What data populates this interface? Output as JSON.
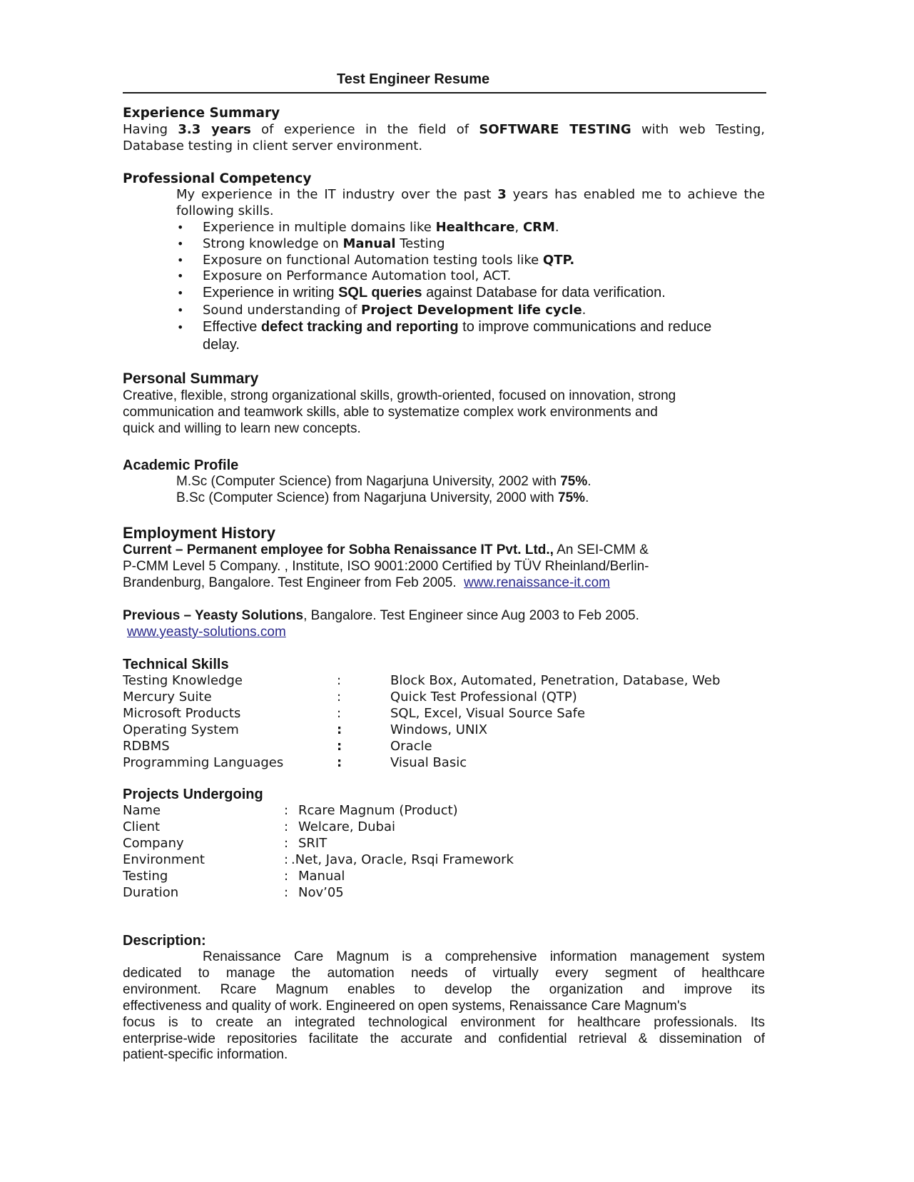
{
  "title": "Test Engineer  Resume",
  "experience_summary": {
    "heading": "Experience Summary",
    "line1_pre": "Having ",
    "line1_b1": "3.3 years",
    "line1_mid": " of experience in the field of ",
    "line1_b2": "SOFTWARE TESTING",
    "line1_post": " with web Testing,",
    "line2": "Database testing in client server environment."
  },
  "professional_competency": {
    "heading": "Professional Competency",
    "intro_pre": "My experience in the IT industry over the past ",
    "intro_b": "3",
    "intro_post": " years has enabled me to achieve the",
    "intro_line2": "following skills.",
    "bullet_glyph": "•",
    "bullets": [
      {
        "pre": "Experience in multiple domains like ",
        "b": "Healthcare",
        "mid": ", ",
        "b2": "CRM",
        "post": "."
      },
      {
        "pre": "Strong knowledge on ",
        "b": "Manual",
        "mid": " Testing",
        "b2": "",
        "post": ""
      },
      {
        "pre": "Exposure on functional Automation testing tools like ",
        "b": "QTP.",
        "mid": "",
        "b2": "",
        "post": ""
      },
      {
        "pre": "Exposure on Performance Automation tool, ACT.",
        "b": "",
        "mid": "",
        "b2": "",
        "post": ""
      },
      {
        "pre": "Experience in writing ",
        "b": "SQL queries",
        "mid": " against Database for data verification.",
        "b2": "",
        "post": ""
      },
      {
        "pre": "Sound understanding of ",
        "b": "Project Development life cycle",
        "mid": ".",
        "b2": "",
        "post": ""
      },
      {
        "pre": "Effective ",
        "b": "defect tracking and reporting",
        "mid": " to improve communications and reduce",
        "b2": "",
        "post": "delay."
      }
    ]
  },
  "personal_summary": {
    "heading": "Personal Summary",
    "lines": [
      "Creative, flexible, strong organizational skills, growth-oriented, focused on innovation, strong",
      "communication and teamwork skills, able to systematize complex work environments and",
      "quick and willing to learn new concepts."
    ]
  },
  "academic_profile": {
    "heading": "Academic Profile",
    "items": [
      {
        "text": "M.Sc (Computer Science) from Nagarjuna University, 2002 with ",
        "b": "75%",
        "post": "."
      },
      {
        "text": "B.Sc (Computer Science) from Nagarjuna University, 2000 with ",
        "b": "75%",
        "post": "."
      }
    ]
  },
  "employment_history": {
    "heading": "Employment History",
    "current_b": "Current – Permanent employee for Sobha Renaissance IT Pvt. Ltd.,",
    "current_post": " An SEI-CMM &",
    "current_line2": "P-CMM Level 5 Company. , Institute, ISO 9001:2000 Certified by TÜV Rheinland/Berlin-",
    "current_line3": "Brandenburg, Bangalore. Test Engineer from Feb 2005.  ",
    "current_link": "www.renaissance-it.com",
    "previous_b": "Previous – Yeasty Solutions",
    "previous_post": ", Bangalore. Test Engineer since Aug 2003 to Feb 2005.",
    "previous_link": "www.yeasty-solutions.com"
  },
  "technical_skills": {
    "heading": "Technical Skills",
    "rows": [
      {
        "label": "Testing Knowledge",
        "sep": ":",
        "value": "Block Box, Automated, Penetration, Database, Web"
      },
      {
        "label": "Mercury Suite",
        "sep": ":",
        "value": "Quick Test Professional (QTP)"
      },
      {
        "label": "Microsoft Products",
        "sep": ":",
        "value": "SQL, Excel, Visual Source Safe"
      },
      {
        "label": "Operating System",
        "sep": ":",
        "value": "Windows, UNIX"
      },
      {
        "label": "RDBMS",
        "sep": ":",
        "value": "Oracle"
      },
      {
        "label": "Programming Languages",
        "sep": ":",
        "value": "Visual Basic"
      }
    ]
  },
  "projects": {
    "heading": "Projects Undergoing",
    "rows": [
      {
        "label": "Name",
        "sep": ":",
        "value": "Rcare Magnum (Product)"
      },
      {
        "label": "Client",
        "sep": ":",
        "value": "Welcare, Dubai"
      },
      {
        "label": "Company",
        "sep": ":",
        "value": "SRIT"
      },
      {
        "label": "Environment",
        "sep": ":",
        "value": ".Net, Java, Oracle, Rsqi Framework"
      },
      {
        "label": "Testing",
        "sep": ":",
        "value": "Manual"
      },
      {
        "label": "Duration",
        "sep": ":",
        "value": "Nov’05"
      }
    ]
  },
  "description": {
    "heading": "Description:",
    "lines": [
      "Renaissance Care Magnum is a comprehensive information management system",
      "dedicated to manage the automation needs of virtually every segment of healthcare",
      "environment. Rcare Magnum enables to develop the organization and improve its",
      "effectiveness and quality of work. Engineered on open systems, Renaissance Care Magnum's",
      "focus is to create an integrated technological environment for healthcare professionals. Its",
      "enterprise-wide repositories facilitate the accurate and confidential retrieval & dissemination of",
      "patient-specific information."
    ]
  },
  "colors": {
    "text": "#141414",
    "link": "#2a2a8c",
    "rule": "#1a1a1a"
  }
}
